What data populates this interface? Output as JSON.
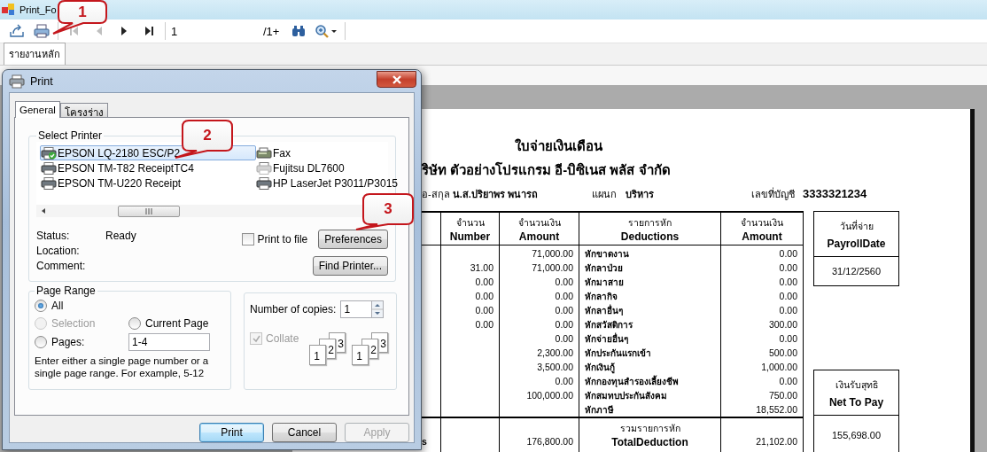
{
  "window": {
    "title": "Print_Fo"
  },
  "toolbar": {
    "buttons": [
      {
        "kind": "export",
        "disabled": false
      },
      {
        "kind": "print",
        "disabled": false
      },
      {
        "kind": "first",
        "disabled": true
      },
      {
        "kind": "prev",
        "disabled": true
      },
      {
        "kind": "next",
        "disabled": false
      },
      {
        "kind": "last",
        "disabled": false
      }
    ],
    "page_value": "1",
    "page_total": "/1+",
    "tools": [
      {
        "kind": "find"
      },
      {
        "kind": "zoom"
      }
    ]
  },
  "report_tabs": [
    {
      "label": "รายงานหลัก",
      "selected": true
    }
  ],
  "report": {
    "title": "ใบจ่ายเงินเดือน",
    "company": "ริษัท ตัวอย่างโปรแกรม อี-บิซิเนส พลัส จำกัด",
    "name_label": "อ-สกุล",
    "name": "น.ส.ปริยาพร พนารถ",
    "department_label": "แผนก",
    "department": "บริหาร",
    "account_label": "เลขที่บัญชี",
    "account": "3333321234",
    "columns": [
      {
        "thai": "จำนวน",
        "english": "Number"
      },
      {
        "thai": "จำนวนเงิน",
        "english": "Amount"
      },
      {
        "thai": "รายการหัก",
        "english": "Deductions"
      },
      {
        "thai": "จำนวนเงิน",
        "english": "Amount"
      }
    ],
    "rows": [
      {
        "amount": "71,000.00",
        "deduction": "หักขาดงาน",
        "deduction_amount": "0.00"
      },
      {
        "number": "31.00",
        "amount": "71,000.00",
        "deduction": "หักลาป่วย",
        "deduction_amount": "0.00"
      },
      {
        "number": "0.00",
        "amount": "0.00",
        "deduction": "หักมาสาย",
        "deduction_amount": "0.00"
      },
      {
        "number": "0.00",
        "amount": "0.00",
        "deduction": "หักลากิจ",
        "deduction_amount": "0.00"
      },
      {
        "number": "0.00",
        "amount": "0.00",
        "deduction": "หักลาอื่นๆ",
        "deduction_amount": "0.00"
      },
      {
        "number": "0.00",
        "amount": "0.00",
        "deduction": "หักสวัสดิการ",
        "deduction_amount": "300.00"
      },
      {
        "amount": "0.00",
        "deduction": "หักจ่ายอื่นๆ",
        "deduction_amount": "0.00"
      },
      {
        "amount": "2,300.00",
        "deduction": "หักประกันแรกเข้า",
        "deduction_amount": "500.00"
      },
      {
        "amount": "3,500.00",
        "deduction": "หักเงินกู้",
        "deduction_amount": "1,000.00"
      },
      {
        "amount": "0.00",
        "deduction": "หักกองทุนสำรองเลี้ยงชีพ",
        "deduction_amount": "0.00"
      },
      {
        "amount": "100,000.00",
        "deduction": "หักสมทบประกันสังคม",
        "deduction_amount": "750.00"
      },
      {
        "deduction": "หักภาษี",
        "deduction_amount": "18,552.00"
      }
    ],
    "total": {
      "column_1": "s",
      "amount": "176,800.00",
      "label_thai": "รวมรายการหัก",
      "label_english": "TotalDeduction",
      "deduction_amount": "21,102.00"
    },
    "payroll_date": {
      "thai": "วันที่จ่าย",
      "english": "PayrollDate",
      "value": "31/12/2560"
    },
    "net_pay": {
      "thai": "เงินรับสุทธิ",
      "english": "Net To Pay",
      "value": "155,698.00"
    }
  },
  "dialog": {
    "title": "Print",
    "tabs": [
      {
        "label": "General",
        "selected": true
      },
      {
        "label": "โครงร่าง",
        "selected": false
      }
    ],
    "select_printer": {
      "label": "Select Printer",
      "printers": [
        {
          "name": "EPSON LQ-2180 ESC/P2",
          "kind": "printer",
          "selected": true,
          "default": true,
          "offline": false
        },
        {
          "name": "EPSON TM-T82 ReceiptTC4",
          "kind": "printer",
          "selected": false,
          "default": false,
          "offline": false
        },
        {
          "name": "EPSON TM-U220 Receipt",
          "kind": "printer",
          "selected": false,
          "default": false,
          "offline": false
        },
        {
          "name": "Fax",
          "kind": "fax",
          "selected": false,
          "default": false,
          "offline": false
        },
        {
          "name": "Fujitsu DL7600",
          "kind": "printer",
          "selected": false,
          "default": false,
          "offline": true
        },
        {
          "name": "HP LaserJet P3011/P3015",
          "kind": "printer",
          "selected": false,
          "default": false,
          "offline": false
        }
      ],
      "status_label": "Status:",
      "status": "Ready",
      "location_label": "Location:",
      "comment_label": "Comment:",
      "print_to_file": {
        "label": "Print to file",
        "checked": false
      },
      "preferences_button": "Preferences",
      "find_printer_button": "Find Printer..."
    },
    "page_range": {
      "label": "Page Range",
      "options": [
        {
          "label": "All",
          "selected": true,
          "disabled": false
        },
        {
          "label": "Selection",
          "selected": false,
          "disabled": true
        },
        {
          "label": "Current Page",
          "selected": false,
          "disabled": false
        },
        {
          "label": "Pages:",
          "selected": false,
          "disabled": false
        }
      ],
      "pages_value": "1-4",
      "hint": "Enter either a single page number or a single page range.  For example, 5-12"
    },
    "copies": {
      "label": "Number of copies:",
      "value": "1",
      "collate": {
        "label": "Collate",
        "checked": true,
        "disabled": true
      },
      "collate_illustration": [
        {
          "pages": [
            "1",
            "2",
            "3"
          ]
        },
        {
          "pages": [
            "1",
            "2",
            "3"
          ]
        }
      ]
    },
    "buttons": [
      {
        "label": "Print",
        "default": true,
        "disabled": false
      },
      {
        "label": "Cancel",
        "default": false,
        "disabled": false
      },
      {
        "label": "Apply",
        "default": false,
        "disabled": true
      }
    ]
  },
  "callouts": [
    {
      "label": "1"
    },
    {
      "label": "2"
    },
    {
      "label": "3"
    }
  ]
}
